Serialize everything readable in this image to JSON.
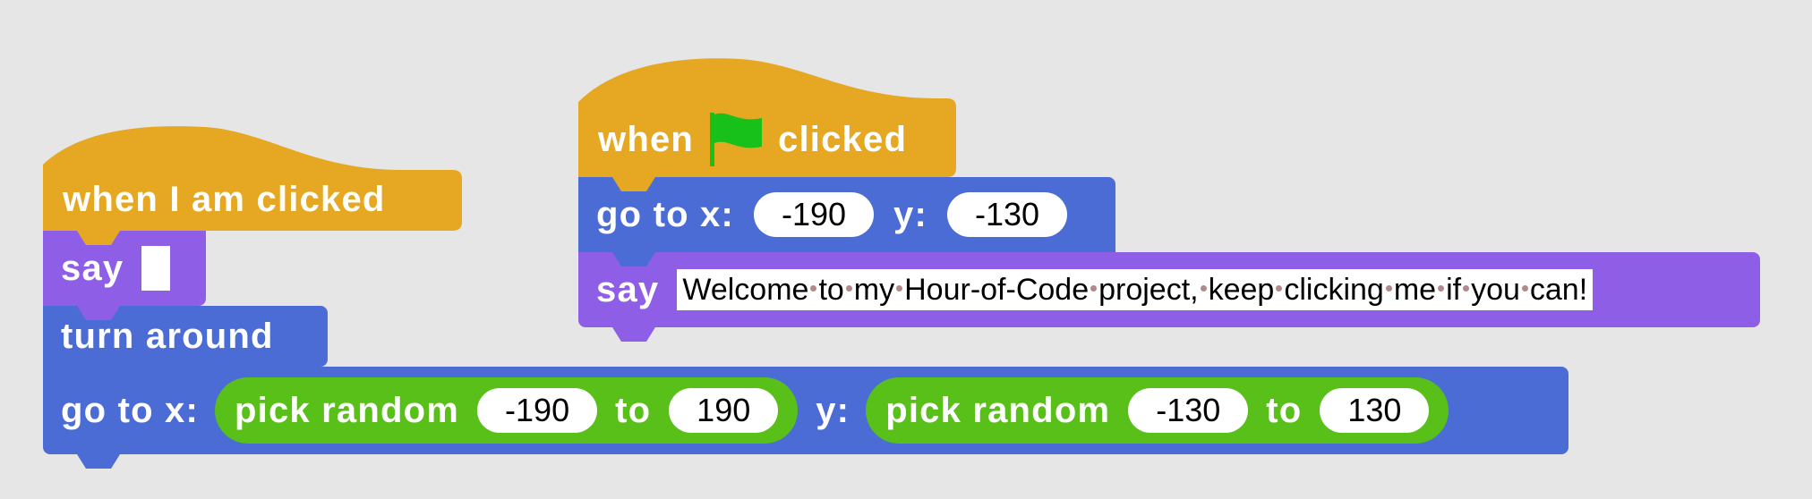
{
  "colors": {
    "events": "#e6a823",
    "looks": "#8f5ee6",
    "motion": "#4b6cd4",
    "operators": "#59c01a",
    "flag": "#18c11a",
    "canvas": "#e6e6e6"
  },
  "script_left": {
    "hat": {
      "label": "when I am clicked"
    },
    "say": {
      "label": "say",
      "value": ""
    },
    "turn": {
      "label": "turn around"
    },
    "goto": {
      "label_x": "go to x:",
      "label_y": "y:",
      "x_random": {
        "label": "pick random",
        "from": "-190",
        "to_label": "to",
        "to": "190"
      },
      "y_random": {
        "label": "pick random",
        "from": "-130",
        "to_label": "to",
        "to": "130"
      }
    }
  },
  "script_right": {
    "hat": {
      "label_when": "when",
      "flag_icon": "green-flag-icon",
      "label_clicked": "clicked"
    },
    "goto": {
      "label_x": "go to x:",
      "x": "-190",
      "label_y": "y:",
      "y": "-130"
    },
    "say": {
      "label": "say",
      "words": [
        "Welcome",
        "to",
        "my",
        "Hour-of-Code",
        "project,",
        "keep",
        "clicking",
        "me",
        "if",
        "you",
        "can!"
      ]
    }
  }
}
